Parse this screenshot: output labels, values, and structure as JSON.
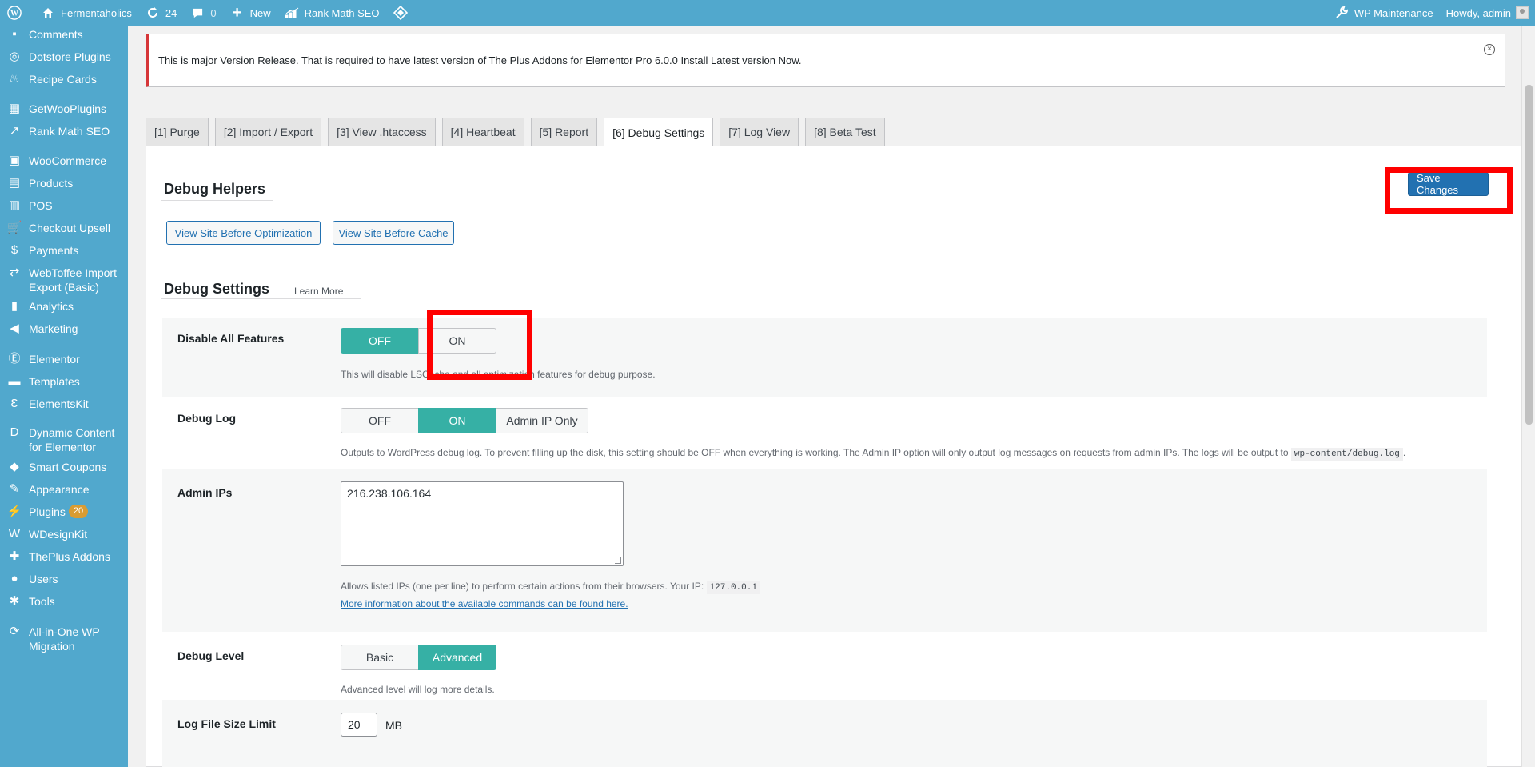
{
  "adminbar": {
    "site_name": "Fermentaholics",
    "updates_count": "24",
    "comments_count": "0",
    "new_label": "New",
    "rank_math_label": "Rank Math SEO",
    "wp_maintenance_label": "WP Maintenance",
    "howdy_label": "Howdy, admin"
  },
  "sidebar": {
    "items": [
      {
        "label": "Comments",
        "icon": "comment-icon"
      },
      {
        "label": "Dotstore Plugins",
        "icon": "dotstore-icon"
      },
      {
        "label": "Recipe Cards",
        "icon": "chef-hat-icon"
      },
      {
        "label": "GetWooPlugins",
        "icon": "plugins-grid-icon"
      },
      {
        "label": "Rank Math SEO",
        "icon": "chart-icon"
      },
      {
        "label": "WooCommerce",
        "icon": "woo-icon"
      },
      {
        "label": "Products",
        "icon": "archive-icon"
      },
      {
        "label": "POS",
        "icon": "pos-icon"
      },
      {
        "label": "Checkout Upsell",
        "icon": "cart-icon"
      },
      {
        "label": "Payments",
        "icon": "dollar-icon"
      },
      {
        "label": "WebToffee Import Export (Basic)",
        "icon": "import-export-icon"
      },
      {
        "label": "Analytics",
        "icon": "bar-chart-icon"
      },
      {
        "label": "Marketing",
        "icon": "megaphone-icon"
      },
      {
        "label": "Elementor",
        "icon": "elementor-icon"
      },
      {
        "label": "Templates",
        "icon": "folder-icon"
      },
      {
        "label": "ElementsKit",
        "icon": "elementskit-icon"
      },
      {
        "label": "Dynamic Content for Elementor",
        "icon": "dynamic-content-icon"
      },
      {
        "label": "Smart Coupons",
        "icon": "tag-icon"
      },
      {
        "label": "Appearance",
        "icon": "brush-icon"
      },
      {
        "label": "Plugins",
        "icon": "plugin-icon",
        "badge": "20"
      },
      {
        "label": "WDesignKit",
        "icon": "wdesignkit-icon"
      },
      {
        "label": "ThePlus Addons",
        "icon": "theplus-icon"
      },
      {
        "label": "Users",
        "icon": "user-icon"
      },
      {
        "label": "Tools",
        "icon": "wrench-icon"
      },
      {
        "label": "All-in-One WP Migration",
        "icon": "migration-icon"
      }
    ]
  },
  "notice": {
    "text": "This is major Version Release. That is required to have latest version of The Plus Addons for Elementor Pro 6.0.0 Install Latest version Now.",
    "dismiss": "×"
  },
  "tabs": [
    {
      "label": "[1] Purge"
    },
    {
      "label": "[2] Import / Export"
    },
    {
      "label": "[3] View .htaccess"
    },
    {
      "label": "[4] Heartbeat"
    },
    {
      "label": "[5] Report"
    },
    {
      "label": "[6] Debug Settings",
      "active": true
    },
    {
      "label": "[7] Log View"
    },
    {
      "label": "[8] Beta Test"
    }
  ],
  "debug_helpers": {
    "title": "Debug Helpers",
    "save_label": "Save Changes",
    "view_before_optimization": "View Site Before Optimization",
    "view_before_cache": "View Site Before Cache"
  },
  "debug_settings": {
    "title": "Debug Settings",
    "learn_more": "Learn More",
    "disable_all": {
      "label": "Disable All Features",
      "off": "OFF",
      "on": "ON",
      "selected": "OFF",
      "desc": "This will disable LSCache and all optimization features for debug purpose."
    },
    "debug_log": {
      "label": "Debug Log",
      "off": "OFF",
      "on": "ON",
      "admin_ip": "Admin IP Only",
      "selected": "ON",
      "desc": "Outputs to WordPress debug log. To prevent filling up the disk, this setting should be OFF when everything is working. The Admin IP option will only output log messages on requests from admin IPs. The logs will be output to",
      "path": "wp-content/debug.log",
      "desc_end": "."
    },
    "admin_ips": {
      "label": "Admin IPs",
      "value": "216.238.106.164",
      "desc": "Allows listed IPs (one per line) to perform certain actions from their browsers. Your IP:",
      "your_ip": "127.0.0.1",
      "more_info": "More information about the available commands can be found here."
    },
    "debug_level": {
      "label": "Debug Level",
      "basic": "Basic",
      "advanced": "Advanced",
      "selected": "Advanced",
      "desc": "Advanced level will log more details."
    },
    "log_file_size": {
      "label": "Log File Size Limit",
      "value": "20",
      "unit": "MB"
    }
  },
  "colors": {
    "accent": "#51a8cd",
    "toggle_on": "#36b0a5",
    "primary_button": "#2271b1",
    "highlight": "#ff0000"
  }
}
